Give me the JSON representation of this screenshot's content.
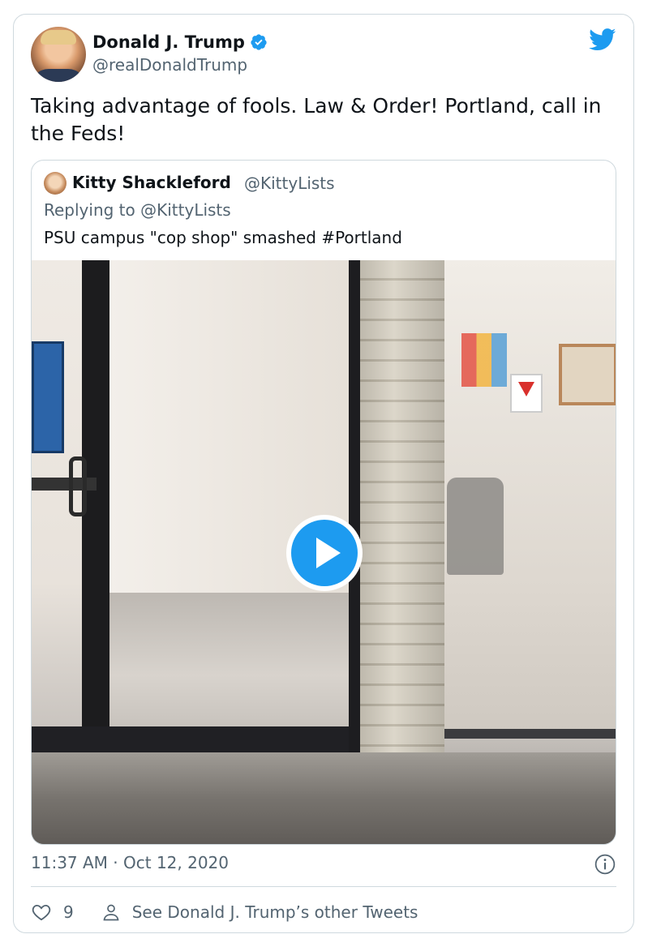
{
  "tweet": {
    "author_name": "Donald J. Trump",
    "author_handle": "@realDonaldTrump",
    "text": "Taking advantage of fools. Law & Order! Portland, call in the Feds!",
    "timestamp": "11:37 AM · Oct 12, 2020",
    "like_count": "9",
    "see_more_label": "See Donald J. Trump’s other Tweets",
    "icons": {
      "verified": "verified-badge-icon",
      "brand": "twitter-bird-icon",
      "info": "info-icon",
      "like": "heart-icon",
      "profile": "person-icon"
    }
  },
  "quoted_tweet": {
    "author_name": "Kitty Shackleford",
    "author_handle": "@KittyLists",
    "replying_to_prefix": "Replying to",
    "replying_to_handle": "@KittyLists",
    "text": "PSU campus \"cop shop\" smashed #Portland",
    "media": {
      "type": "video",
      "control": "play-button"
    }
  },
  "colors": {
    "accent": "#1d9bf0",
    "text_primary": "#0f1419",
    "text_secondary": "#536471",
    "border": "#cfd9de"
  }
}
